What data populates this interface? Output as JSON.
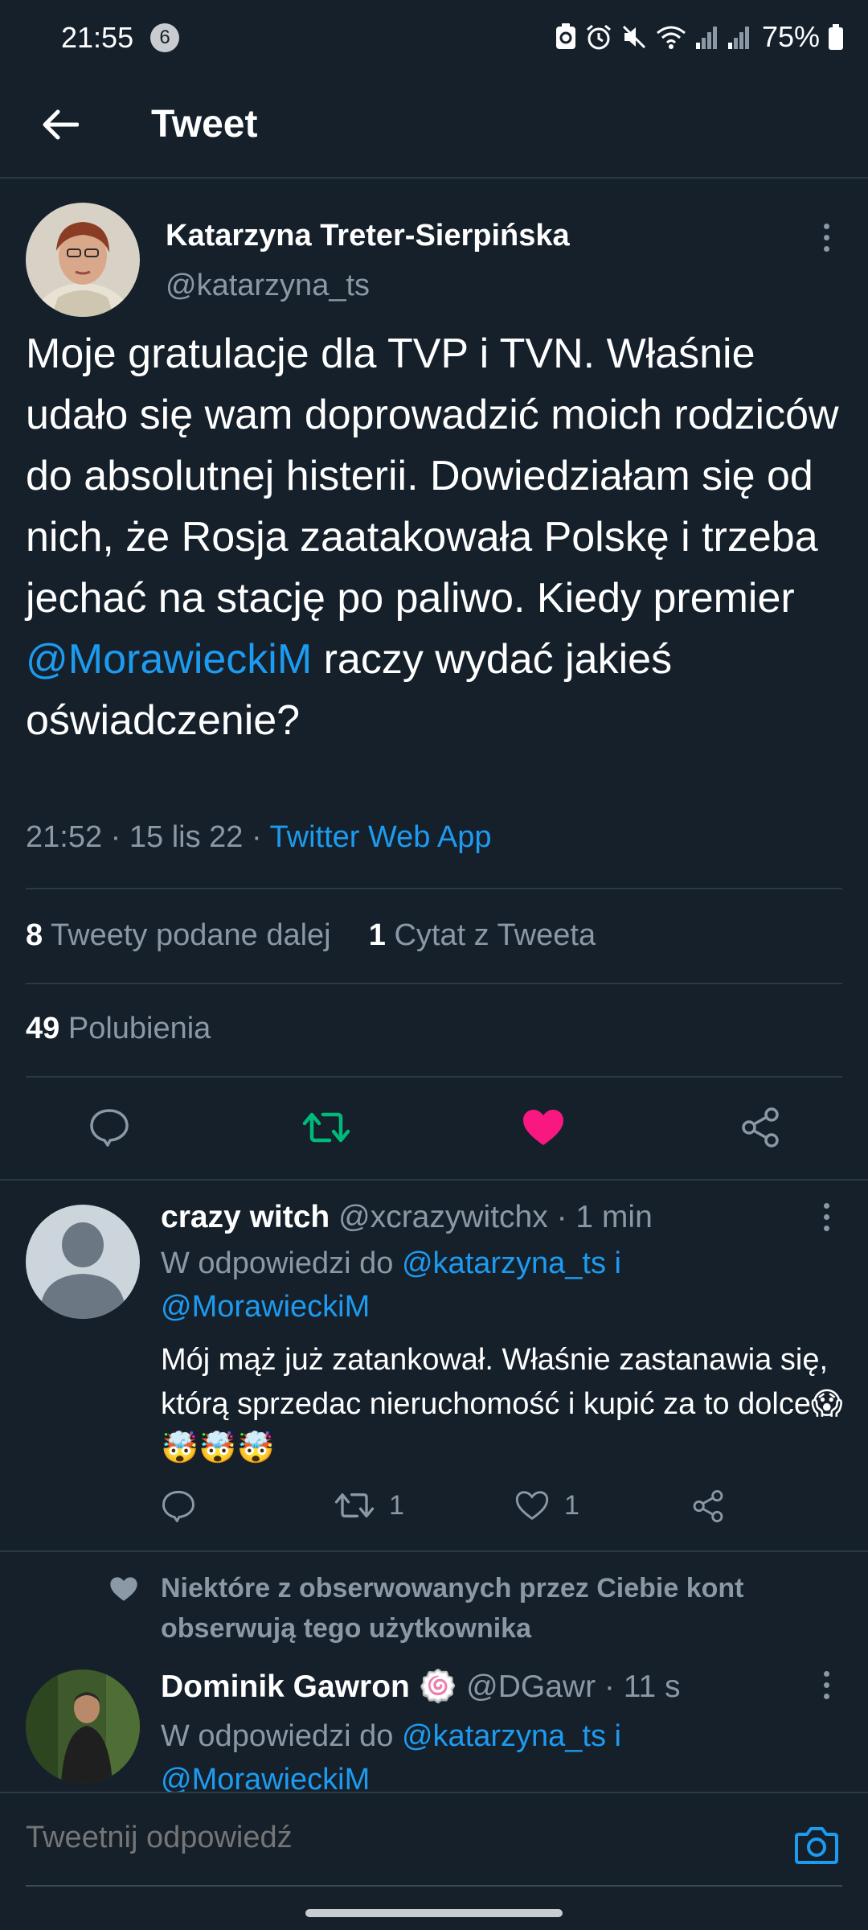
{
  "status_bar": {
    "time": "21:55",
    "notification_count": "6",
    "battery": "75%"
  },
  "header": {
    "title": "Tweet"
  },
  "main_tweet": {
    "author_name": "Katarzyna Treter-Sierpińska",
    "author_handle": "@katarzyna_ts",
    "text_before_mention": "Moje gratulacje dla TVP i TVN. Właśnie udało się wam doprowadzić moich rodziców do absolutnej histerii. Dowiedziałam się od nich, że Rosja zaatakowała Polskę i trzeba jechać na stację po paliwo. Kiedy premier ",
    "mention": "@MorawieckiM",
    "text_after_mention": " raczy wydać jakieś oświadczenie?",
    "time": "21:52",
    "date": "15 lis 22",
    "source": "Twitter Web App",
    "separator": " · ",
    "retweets_count": "8",
    "retweets_label": "Tweety podane dalej",
    "quotes_count": "1",
    "quotes_label": "Cytat z Tweeta",
    "likes_count": "49",
    "likes_label": "Polubienia",
    "liked": true
  },
  "replies": [
    {
      "name": "crazy witch",
      "handle": "@xcrazywitchx",
      "time": "1 min",
      "context_prefix": "W odpowiedzi do",
      "context_mention_1": "@katarzyna_ts",
      "context_joiner": "i",
      "context_mention_2": "@MorawieckiM",
      "text": "Mój mąż już zatankował. Właśnie zastanawia się, którą sprzedac nieruchomość i kupić za to dolce😱🤯🤯🤯",
      "retweet_count": "1",
      "like_count": "1"
    },
    {
      "social_context": "Niektóre z obserwowanych przez Ciebie kont obserwują tego użytkownika",
      "name": "Dominik Gawron",
      "badge": "🍥",
      "handle": "@DGawr",
      "time": "11 s",
      "context_prefix": "W odpowiedzi do",
      "context_mention_1": "@katarzyna_ts",
      "context_joiner": "i",
      "context_mention_2": "@MorawieckiM"
    }
  ],
  "compose": {
    "placeholder": "Tweetnij odpowiedź"
  },
  "colors": {
    "background": "#15202b",
    "accent": "#1d9bf0",
    "retweet_green": "#00ba7c",
    "like_pink": "#f91880",
    "muted": "#8b98a5"
  },
  "icons": {
    "back": "arrow-left-icon",
    "reply": "speech-bubble-icon",
    "retweet": "retweet-icon",
    "like": "heart-icon",
    "share": "share-icon",
    "camera": "camera-icon",
    "more": "more-vertical-icon"
  }
}
